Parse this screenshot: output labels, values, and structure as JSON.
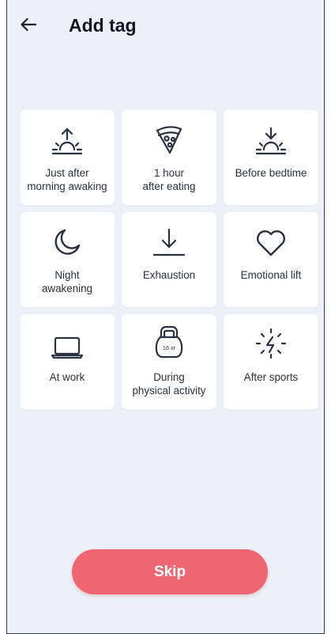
{
  "header": {
    "title": "Add tag"
  },
  "tags": [
    {
      "label": "Just after\nmorning awaking",
      "icon": "sunrise-icon"
    },
    {
      "label": "1 hour\nafter eating",
      "icon": "pizza-icon"
    },
    {
      "label": "Before bedtime",
      "icon": "sunset-icon"
    },
    {
      "label": "Night\nawakening",
      "icon": "moon-icon"
    },
    {
      "label": "Exhaustion",
      "icon": "arrow-down-to-line-icon"
    },
    {
      "label": "Emotional lift",
      "icon": "heart-icon"
    },
    {
      "label": "At work",
      "icon": "laptop-icon"
    },
    {
      "label": "During\nphysical activity",
      "icon": "kettlebell-icon",
      "icon_text": "16 кг"
    },
    {
      "label": "After sports",
      "icon": "energy-icon"
    }
  ],
  "skip_label": "Skip",
  "colors": {
    "background": "#edf0f9",
    "tile": "#ffffff",
    "icon": "#2a3242",
    "accent": "#ee6672",
    "text": "#2b313d"
  }
}
